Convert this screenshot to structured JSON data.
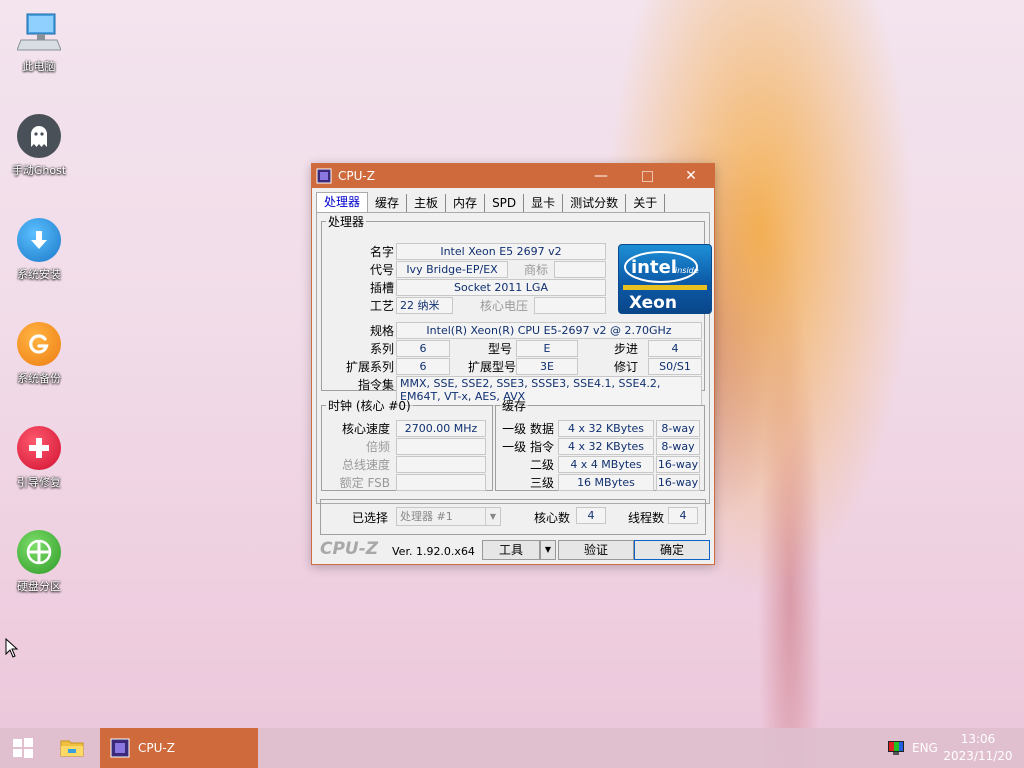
{
  "desktop": {
    "icons": [
      {
        "label": "此电脑",
        "icon": "computer-icon"
      },
      {
        "label": "手动Ghost",
        "icon": "ghost-icon"
      },
      {
        "label": "系统安装",
        "icon": "install-icon"
      },
      {
        "label": "系统备份",
        "icon": "backup-icon"
      },
      {
        "label": "引导修复",
        "icon": "repair-icon"
      },
      {
        "label": "硬盘分区",
        "icon": "partition-icon"
      }
    ]
  },
  "window": {
    "title": "CPU-Z",
    "tabs": [
      "处理器",
      "缓存",
      "主板",
      "内存",
      "SPD",
      "显卡",
      "测试分数",
      "关于"
    ],
    "active_tab": 0,
    "processor": {
      "group_label": "处理器",
      "name_label": "名字",
      "name": "Intel Xeon E5 2697 v2",
      "codename_label": "代号",
      "codename": "Ivy Bridge-EP/EX",
      "brand_label": "商标",
      "brand": "",
      "package_label": "插槽",
      "package": "Socket 2011 LGA",
      "tech_label": "工艺",
      "tech": "22 纳米",
      "voltage_label": "核心电压",
      "voltage": "",
      "spec_label": "规格",
      "spec": "Intel(R) Xeon(R) CPU E5-2697 v2 @ 2.70GHz",
      "family_label": "系列",
      "family": "6",
      "model_label": "型号",
      "model": "E",
      "stepping_label": "步进",
      "stepping": "4",
      "ext_family_label": "扩展系列",
      "ext_family": "6",
      "ext_model_label": "扩展型号",
      "ext_model": "3E",
      "revision_label": "修订",
      "revision": "S0/S1",
      "instructions_label": "指令集",
      "instructions": "MMX, SSE, SSE2, SSE3, SSSE3, SSE4.1, SSE4.2, EM64T, VT-x, AES, AVX",
      "logo_brand": "intel",
      "logo_inside": "inside",
      "logo_product": "Xeon"
    },
    "clocks": {
      "group_label": "时钟 (核心 #0)",
      "core_speed_label": "核心速度",
      "core_speed": "2700.00 MHz",
      "multiplier_label": "倍频",
      "multiplier": "",
      "bus_speed_label": "总线速度",
      "bus_speed": "",
      "rated_fsb_label": "额定 FSB",
      "rated_fsb": ""
    },
    "cache": {
      "group_label": "缓存",
      "rows": [
        {
          "label": "一级 数据",
          "size": "4 x 32 KBytes",
          "way": "8-way"
        },
        {
          "label": "一级 指令",
          "size": "4 x 32 KBytes",
          "way": "8-way"
        },
        {
          "label": "二级",
          "size": "4 x 4 MBytes",
          "way": "16-way"
        },
        {
          "label": "三级",
          "size": "16 MBytes",
          "way": "16-way"
        }
      ]
    },
    "selection": {
      "selected_label": "已选择",
      "selected_value": "处理器 #1",
      "cores_label": "核心数",
      "cores": "4",
      "threads_label": "线程数",
      "threads": "4"
    },
    "footer": {
      "logo": "CPU-Z",
      "version": "Ver. 1.92.0.x64",
      "tools_label": "工具",
      "validate_label": "验证",
      "ok_label": "确定"
    }
  },
  "taskbar": {
    "app_label": "CPU-Z",
    "lang": "ENG",
    "time": "13:06",
    "date": "2023/11/20"
  },
  "colors": {
    "accent": "#cf6a3c",
    "value_text": "#103070",
    "active_tab_text": "#0000cc"
  }
}
